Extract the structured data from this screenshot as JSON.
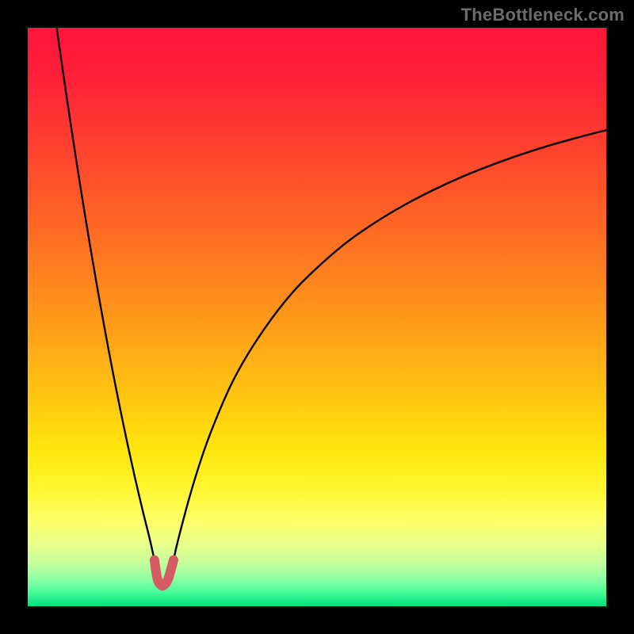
{
  "watermark": "TheBottleneck.com",
  "colors": {
    "black": "#000000",
    "curve": "#000000",
    "u_marker": "#d55b63",
    "gradient_stops": [
      {
        "offset": 0.0,
        "color": "#ff153b"
      },
      {
        "offset": 0.08,
        "color": "#ff1f39"
      },
      {
        "offset": 0.2,
        "color": "#ff3f2f"
      },
      {
        "offset": 0.35,
        "color": "#ff6a24"
      },
      {
        "offset": 0.5,
        "color": "#ff981a"
      },
      {
        "offset": 0.62,
        "color": "#ffbf12"
      },
      {
        "offset": 0.73,
        "color": "#ffe60d"
      },
      {
        "offset": 0.8,
        "color": "#fff733"
      },
      {
        "offset": 0.85,
        "color": "#fdff66"
      },
      {
        "offset": 0.89,
        "color": "#eaff88"
      },
      {
        "offset": 0.925,
        "color": "#c6ff9c"
      },
      {
        "offset": 0.955,
        "color": "#88ffa4"
      },
      {
        "offset": 0.975,
        "color": "#4cfd9a"
      },
      {
        "offset": 0.99,
        "color": "#1de987"
      },
      {
        "offset": 1.0,
        "color": "#00e27d"
      }
    ]
  },
  "chart_data": {
    "type": "line",
    "title": "",
    "xlabel": "",
    "ylabel": "",
    "x_range": [
      0,
      100
    ],
    "y_range": [
      0,
      100
    ],
    "series": [
      {
        "name": "left_branch",
        "x": [
          5.0,
          6.0,
          7.0,
          8.0,
          9.0,
          10.0,
          11.0,
          12.0,
          13.0,
          14.0,
          15.0,
          16.0,
          17.0,
          18.0,
          19.0,
          20.0,
          21.0,
          21.9
        ],
        "y": [
          100.0,
          93.0,
          86.2,
          79.6,
          73.2,
          67.0,
          61.0,
          55.2,
          49.6,
          44.2,
          39.0,
          34.0,
          29.2,
          24.6,
          20.2,
          16.0,
          12.0,
          8.0
        ]
      },
      {
        "name": "right_branch",
        "x": [
          25.2,
          26.0,
          28.0,
          30.0,
          32.0,
          35.0,
          38.0,
          42.0,
          46.0,
          50.0,
          55.0,
          60.0,
          65.0,
          70.0,
          75.0,
          80.0,
          85.0,
          90.0,
          95.0,
          100.0
        ],
        "y": [
          8.0,
          11.5,
          19.0,
          25.5,
          31.0,
          38.0,
          43.5,
          49.5,
          54.5,
          58.5,
          62.8,
          66.3,
          69.3,
          71.9,
          74.2,
          76.2,
          78.0,
          79.6,
          81.0,
          82.3
        ]
      },
      {
        "name": "u_bottom_marker",
        "x": [
          21.9,
          22.4,
          23.0,
          23.6,
          24.3,
          25.2
        ],
        "y": [
          8.0,
          4.8,
          3.7,
          3.7,
          4.8,
          8.0
        ]
      }
    ],
    "minimum": {
      "x": 23.3,
      "y": 3.6
    }
  }
}
